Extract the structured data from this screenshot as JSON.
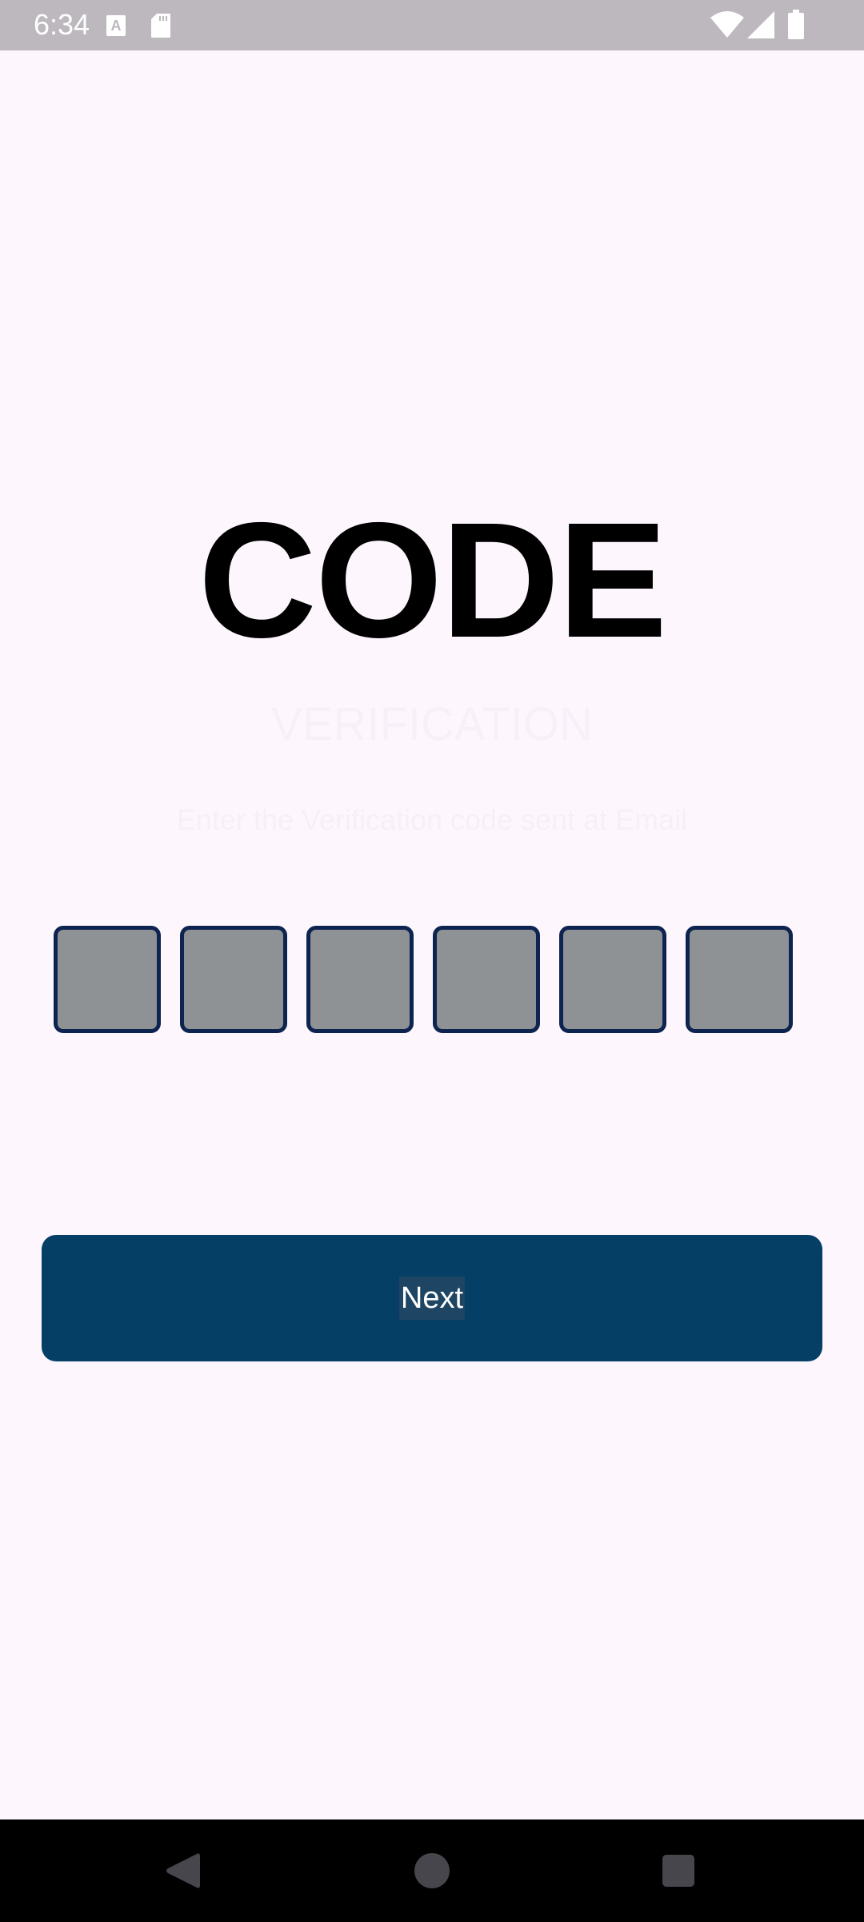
{
  "status_bar": {
    "time": "6:34",
    "icons": [
      "a-notification-icon",
      "sd-card-icon",
      "wifi-icon",
      "cellular-signal-icon",
      "battery-icon"
    ]
  },
  "verification": {
    "title": "CODE",
    "subtitle": "VERIFICATION",
    "instruction": "Enter the Verification code sent at Email",
    "digits": [
      "",
      "",
      "",
      "",
      "",
      ""
    ]
  },
  "actions": {
    "next_label": "Next"
  },
  "nav_bar": {
    "icons": [
      "back-icon",
      "home-icon",
      "recents-icon"
    ]
  },
  "colors": {
    "background": "#FDF7FD",
    "status_bar": "#BCB8BD",
    "code_box_fill": "#8E9295",
    "code_box_border": "#0E2450",
    "button": "#053F66",
    "nav_bar": "#000000"
  }
}
